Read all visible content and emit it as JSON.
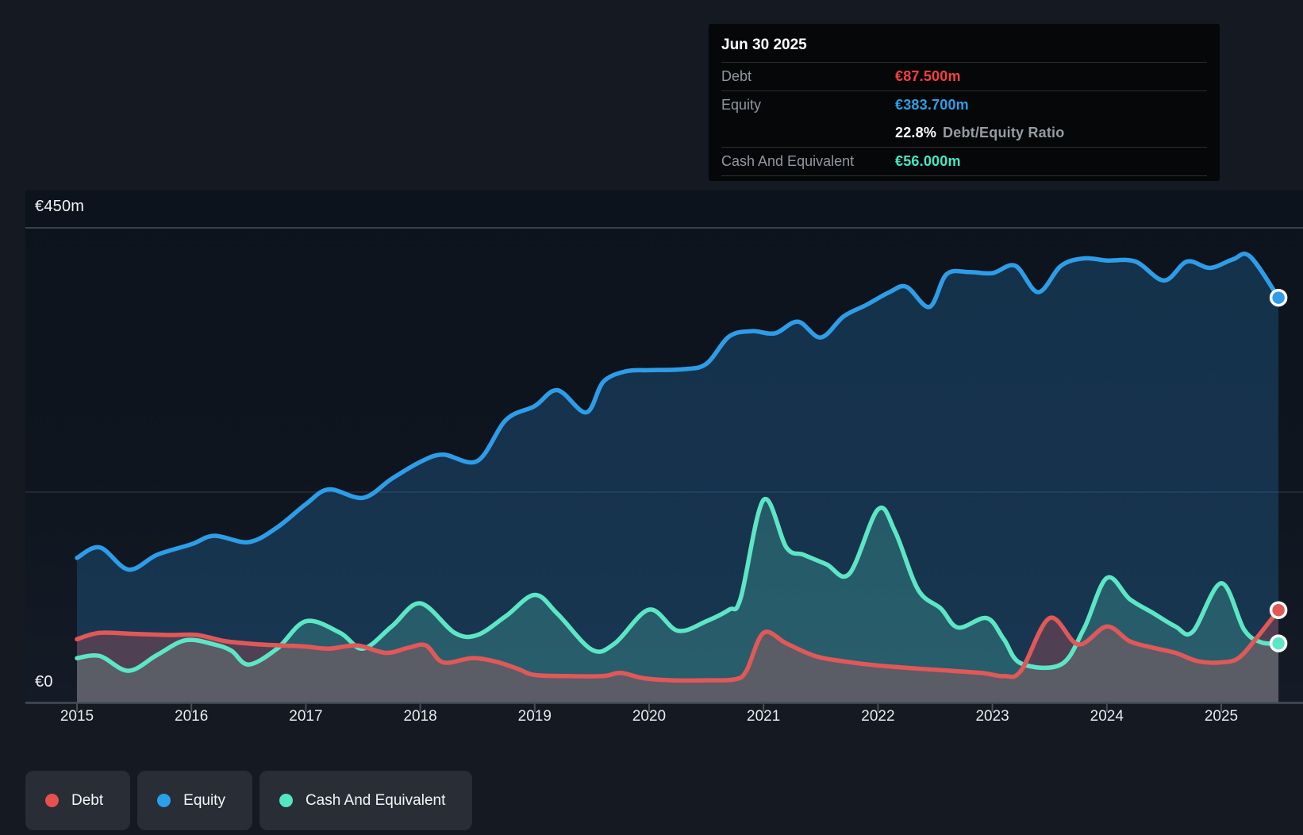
{
  "tooltip": {
    "date": "Jun 30 2025",
    "debt_label": "Debt",
    "debt_value": "€87.500m",
    "equity_label": "Equity",
    "equity_value": "€383.700m",
    "ratio_value": "22.8%",
    "ratio_label": "Debt/Equity Ratio",
    "cash_label": "Cash And Equivalent",
    "cash_value": "€56.000m"
  },
  "y_axis": {
    "top_label": "€450m",
    "bottom_label": "€0"
  },
  "x_axis": {
    "years": [
      "2015",
      "2016",
      "2017",
      "2018",
      "2019",
      "2020",
      "2021",
      "2022",
      "2023",
      "2024",
      "2025"
    ]
  },
  "legend": [
    {
      "label": "Debt",
      "color": "#e8504f"
    },
    {
      "label": "Equity",
      "color": "#2b9fe8"
    },
    {
      "label": "Cash And Equivalent",
      "color": "#55e5c2"
    }
  ],
  "chart_data": {
    "type": "area",
    "unit": "EUR millions",
    "title": "Debt, Equity and Cash And Equivalent history",
    "x_range": [
      2015,
      2025.5
    ],
    "y_range": [
      0,
      450
    ],
    "y_gridline_values": [
      450,
      200,
      0
    ],
    "grid": true,
    "legend_position": "bottom-left",
    "last_point_date": "Jun 30 2025",
    "series": [
      {
        "name": "Equity",
        "color": "#2e9de8",
        "fill": "rgba(44,138,214,0.25)",
        "end_value": 383.7,
        "points": [
          [
            2015.0,
            137
          ],
          [
            2015.2,
            147
          ],
          [
            2015.45,
            126
          ],
          [
            2015.7,
            140
          ],
          [
            2016.0,
            150
          ],
          [
            2016.2,
            158
          ],
          [
            2016.5,
            152
          ],
          [
            2016.75,
            166
          ],
          [
            2017.0,
            188
          ],
          [
            2017.2,
            202
          ],
          [
            2017.5,
            194
          ],
          [
            2017.75,
            212
          ],
          [
            2018.0,
            228
          ],
          [
            2018.2,
            235
          ],
          [
            2018.5,
            229
          ],
          [
            2018.75,
            268
          ],
          [
            2019.0,
            281
          ],
          [
            2019.2,
            296
          ],
          [
            2019.45,
            275
          ],
          [
            2019.6,
            304
          ],
          [
            2019.8,
            314
          ],
          [
            2020.0,
            315
          ],
          [
            2020.3,
            316
          ],
          [
            2020.5,
            321
          ],
          [
            2020.7,
            347
          ],
          [
            2020.9,
            352
          ],
          [
            2021.1,
            350
          ],
          [
            2021.3,
            361
          ],
          [
            2021.5,
            346
          ],
          [
            2021.7,
            366
          ],
          [
            2021.9,
            377
          ],
          [
            2022.1,
            389
          ],
          [
            2022.25,
            394
          ],
          [
            2022.45,
            375
          ],
          [
            2022.6,
            406
          ],
          [
            2022.8,
            408
          ],
          [
            2023.0,
            407
          ],
          [
            2023.2,
            414
          ],
          [
            2023.4,
            389
          ],
          [
            2023.6,
            414
          ],
          [
            2023.8,
            421
          ],
          [
            2024.0,
            419
          ],
          [
            2024.25,
            418
          ],
          [
            2024.5,
            400
          ],
          [
            2024.7,
            418
          ],
          [
            2024.9,
            412
          ],
          [
            2025.1,
            420
          ],
          [
            2025.25,
            423
          ],
          [
            2025.5,
            383.7
          ]
        ]
      },
      {
        "name": "Cash And Equivalent",
        "color": "#5de6c5",
        "fill": "rgba(95,232,199,0.22)",
        "end_value": 56.0,
        "points": [
          [
            2015.0,
            42
          ],
          [
            2015.2,
            44
          ],
          [
            2015.45,
            30
          ],
          [
            2015.7,
            45
          ],
          [
            2015.95,
            59
          ],
          [
            2016.2,
            55
          ],
          [
            2016.35,
            49
          ],
          [
            2016.5,
            36
          ],
          [
            2016.75,
            51
          ],
          [
            2017.0,
            77
          ],
          [
            2017.3,
            66
          ],
          [
            2017.5,
            51
          ],
          [
            2017.75,
            72
          ],
          [
            2018.0,
            94
          ],
          [
            2018.3,
            66
          ],
          [
            2018.5,
            64
          ],
          [
            2018.75,
            82
          ],
          [
            2019.0,
            102
          ],
          [
            2019.2,
            84
          ],
          [
            2019.5,
            50
          ],
          [
            2019.7,
            56
          ],
          [
            2020.0,
            88
          ],
          [
            2020.25,
            68
          ],
          [
            2020.5,
            77
          ],
          [
            2020.7,
            88
          ],
          [
            2020.8,
            99
          ],
          [
            2021.0,
            192
          ],
          [
            2021.2,
            147
          ],
          [
            2021.35,
            140
          ],
          [
            2021.55,
            131
          ],
          [
            2021.75,
            122
          ],
          [
            2022.0,
            183
          ],
          [
            2022.15,
            162
          ],
          [
            2022.35,
            107
          ],
          [
            2022.55,
            89
          ],
          [
            2022.7,
            71
          ],
          [
            2022.95,
            80
          ],
          [
            2023.1,
            60
          ],
          [
            2023.25,
            37
          ],
          [
            2023.6,
            36
          ],
          [
            2023.8,
            70
          ],
          [
            2024.0,
            118
          ],
          [
            2024.2,
            98
          ],
          [
            2024.4,
            85
          ],
          [
            2024.6,
            72
          ],
          [
            2024.75,
            67
          ],
          [
            2025.0,
            113
          ],
          [
            2025.2,
            69
          ],
          [
            2025.35,
            57
          ],
          [
            2025.5,
            56
          ]
        ]
      },
      {
        "name": "Debt",
        "color": "#e05858",
        "fill": "rgba(224,90,90,0.28)",
        "end_value": 87.5,
        "points": [
          [
            2015.0,
            60
          ],
          [
            2015.2,
            66
          ],
          [
            2015.5,
            65
          ],
          [
            2015.8,
            64
          ],
          [
            2016.05,
            64
          ],
          [
            2016.3,
            58
          ],
          [
            2016.6,
            55
          ],
          [
            2016.8,
            54
          ],
          [
            2017.0,
            53
          ],
          [
            2017.2,
            51
          ],
          [
            2017.45,
            54
          ],
          [
            2017.7,
            47
          ],
          [
            2017.9,
            52
          ],
          [
            2018.05,
            54
          ],
          [
            2018.2,
            38
          ],
          [
            2018.45,
            42
          ],
          [
            2018.65,
            39
          ],
          [
            2018.85,
            32
          ],
          [
            2019.0,
            26
          ],
          [
            2019.3,
            25
          ],
          [
            2019.6,
            25
          ],
          [
            2019.75,
            28
          ],
          [
            2019.95,
            23
          ],
          [
            2020.2,
            21
          ],
          [
            2020.5,
            21
          ],
          [
            2020.75,
            22
          ],
          [
            2020.85,
            30
          ],
          [
            2021.0,
            66
          ],
          [
            2021.2,
            56
          ],
          [
            2021.45,
            44
          ],
          [
            2021.7,
            39
          ],
          [
            2022.0,
            35
          ],
          [
            2022.5,
            31
          ],
          [
            2022.9,
            28
          ],
          [
            2023.1,
            25
          ],
          [
            2023.25,
            30
          ],
          [
            2023.5,
            80
          ],
          [
            2023.75,
            55
          ],
          [
            2024.0,
            72
          ],
          [
            2024.2,
            58
          ],
          [
            2024.4,
            52
          ],
          [
            2024.6,
            47
          ],
          [
            2024.8,
            39
          ],
          [
            2025.0,
            38
          ],
          [
            2025.15,
            42
          ],
          [
            2025.3,
            60
          ],
          [
            2025.5,
            87.5
          ]
        ]
      }
    ]
  }
}
